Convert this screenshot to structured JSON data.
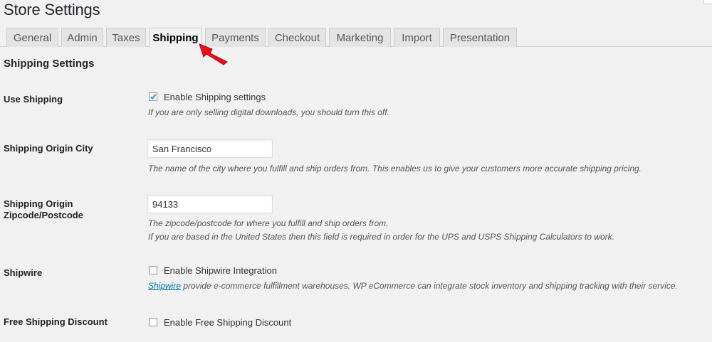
{
  "page": {
    "title": "Store Settings"
  },
  "tabs": [
    {
      "label": "General"
    },
    {
      "label": "Admin"
    },
    {
      "label": "Taxes"
    },
    {
      "label": "Shipping"
    },
    {
      "label": "Payments"
    },
    {
      "label": "Checkout"
    },
    {
      "label": "Marketing"
    },
    {
      "label": "Import"
    },
    {
      "label": "Presentation"
    }
  ],
  "active_tab": "Shipping",
  "section": {
    "title": "Shipping Settings"
  },
  "use_shipping": {
    "label": "Use Shipping",
    "checkbox_label": "Enable Shipping settings",
    "checked": true,
    "description": "If you are only selling digital downloads, you should turn this off."
  },
  "origin_city": {
    "label": "Shipping Origin City",
    "value": "San Francisco",
    "description": "The name of the city where you fulfill and ship orders from. This enables us to give your customers more accurate shipping pricing."
  },
  "origin_zip": {
    "label_line1": "Shipping Origin",
    "label_line2": "Zipcode/Postcode",
    "value": "94133",
    "description_line1": "The zipcode/postcode for where you fulfill and ship orders from.",
    "description_line2": "If you are based in the United States then this field is required in order for the UPS and USPS Shipping Calculators to work."
  },
  "shipwire": {
    "label": "Shipwire",
    "checkbox_label": "Enable Shipwire Integration",
    "checked": false,
    "link_text": "Shipwire",
    "description": " provide e-commerce fulfillment warehouses. WP eCommerce can integrate stock inventory and shipping tracking with their service."
  },
  "free_shipping": {
    "label": "Free Shipping Discount",
    "checkbox_label": "Enable Free Shipping Discount",
    "checked": false
  },
  "colors": {
    "background": "#f1f1f1",
    "tab_inactive": "#e4e4e4",
    "link": "#0073aa",
    "annotation_arrow": "#e8101c"
  },
  "icons": {
    "annotation": "red-arrow-icon",
    "check": "checkmark-icon"
  }
}
